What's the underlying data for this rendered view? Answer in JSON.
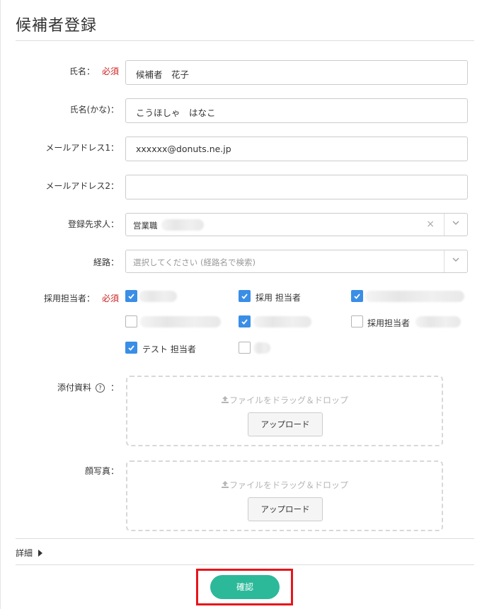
{
  "page": {
    "title": "候補者登録"
  },
  "form": {
    "required_mark": "必須",
    "name": {
      "label": "氏名：",
      "value": "候補者　花子"
    },
    "kana": {
      "label": "氏名(かな)：",
      "value": "こうほしゃ　はなこ"
    },
    "email1": {
      "label": "メールアドレス1：",
      "value": "xxxxxx@donuts.ne.jp"
    },
    "email2": {
      "label": "メールアドレス2：",
      "value": ""
    },
    "job": {
      "label": "登録先求人：",
      "value": "営業職",
      "clear_symbol": "×"
    },
    "route": {
      "label": "経路：",
      "placeholder": "選択してください (経路名で検索)"
    },
    "recruiters": {
      "label": "採用担当者：",
      "items": [
        {
          "label": "",
          "checked": true
        },
        {
          "label": "採用 担当者",
          "checked": true
        },
        {
          "label": "",
          "checked": true
        },
        {
          "label": "",
          "checked": false
        },
        {
          "label": "",
          "checked": true
        },
        {
          "label": "採用担当者",
          "checked": false
        },
        {
          "label": "テスト 担当者",
          "checked": true
        },
        {
          "label": "",
          "checked": false
        }
      ]
    },
    "attachments": {
      "label": "添付資料",
      "help_symbol": "?",
      "colon": "：",
      "drop_text": "ファイルをドラッグ＆ドロップ",
      "upload_label": "アップロード"
    },
    "photo": {
      "label": "顔写真：",
      "drop_text": "ファイルをドラッグ＆ドロップ",
      "upload_label": "アップロード"
    },
    "details_label": "詳細",
    "confirm_label": "確認"
  },
  "colors": {
    "accent": "#3a8ee6",
    "required": "#cc2222",
    "confirm": "#2cb99a",
    "highlight": "#e8141b"
  },
  "icons": [
    "check-icon",
    "chevron-down-icon",
    "clear-icon",
    "upload-icon",
    "help-icon",
    "caret-right-icon"
  ]
}
